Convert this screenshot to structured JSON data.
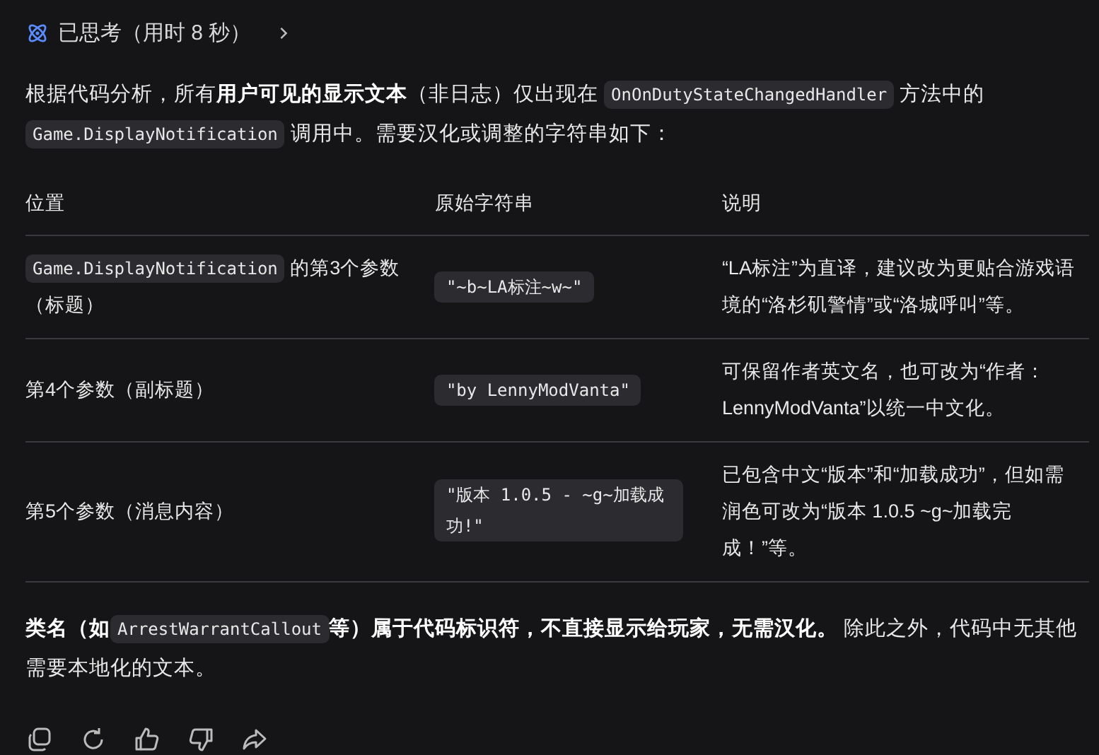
{
  "thinking": {
    "label": "已思考（用时 8 秒）"
  },
  "intro": [
    {
      "kind": "text",
      "text": "根据代码分析，所有**用户可见的显示文本**（非日志）仅出现在 "
    },
    {
      "kind": "code",
      "text": "OnOnDutyStateChangedHandler"
    },
    {
      "kind": "text",
      "text": " 方法中的 "
    },
    {
      "kind": "code",
      "text": "Game.DisplayNotification"
    },
    {
      "kind": "text",
      "text": " 调用中。需要汉化或调整的字符串如下："
    }
  ],
  "table": {
    "columns": [
      "位置",
      "原始字符串",
      "说明"
    ],
    "rows": [
      [
        [
          {
            "kind": "code",
            "text": "Game.DisplayNotification"
          },
          {
            "kind": "text",
            "text": " 的第3个参数（标题）"
          }
        ],
        [
          {
            "kind": "code",
            "text": "\"~b~LA标注~w~\""
          }
        ],
        [
          {
            "kind": "text",
            "text": "“LA标注”为直译，建议改为更贴合游戏语境的“洛杉矶警情”或“洛城呼叫”等。"
          }
        ]
      ],
      [
        [
          {
            "kind": "text",
            "text": "第4个参数（副标题）"
          }
        ],
        [
          {
            "kind": "code",
            "text": "\"by LennyModVanta\""
          }
        ],
        [
          {
            "kind": "text",
            "text": "可保留作者英文名，也可改为“作者：LennyModVanta”以统一中文化。"
          }
        ]
      ],
      [
        [
          {
            "kind": "text",
            "text": "第5个参数（消息内容）"
          }
        ],
        [
          {
            "kind": "code",
            "text": "\"版本 1.0.5 - ~g~加载成功!\""
          }
        ],
        [
          {
            "kind": "text",
            "text": "已包含中文“版本”和“加载成功”，但如需润色可改为“版本 1.0.5 ~g~加载完成！”等。"
          }
        ]
      ]
    ]
  },
  "summary": [
    {
      "kind": "text",
      "text": "**类名（如**"
    },
    {
      "kind": "code",
      "text": "ArrestWarrantCallout"
    },
    {
      "kind": "text",
      "text": "**等）属于代码标识符，不直接显示给玩家，无需汉化。** 除此之外，代码中无其他需要本地化的文本。"
    }
  ],
  "actions": [
    {
      "kind": "copy"
    },
    {
      "kind": "regenerate"
    },
    {
      "kind": "like"
    },
    {
      "kind": "dislike"
    },
    {
      "kind": "share"
    }
  ]
}
